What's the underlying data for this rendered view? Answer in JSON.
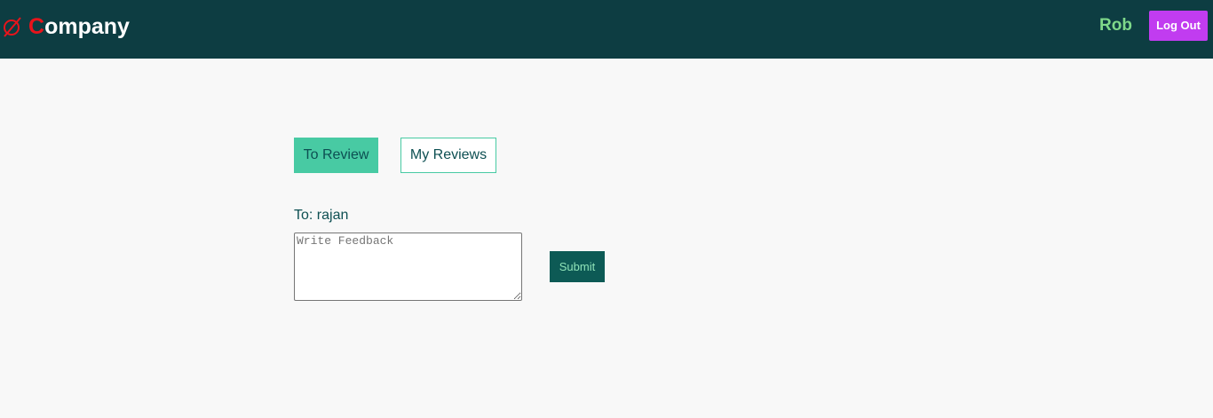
{
  "header": {
    "brand_initial": "C",
    "brand_rest": "ompany",
    "brand_icon": "empty-set-icon",
    "user_name": "Rob",
    "logout_label": "Log Out"
  },
  "tabs": [
    {
      "label": "To Review",
      "active": true
    },
    {
      "label": "My Reviews",
      "active": false
    }
  ],
  "review": {
    "to_label": "To: rajan",
    "feedback_placeholder": "Write Feedback",
    "feedback_value": "",
    "submit_label": "Submit"
  },
  "colors": {
    "navbar_bg": "#0d3d42",
    "brand_accent": "#e8141b",
    "user_name": "#7fd98a",
    "logout_bg": "#c13cf0",
    "tab_active_bg": "#48caa3",
    "submit_bg": "#0d5a55",
    "page_bg": "#f8f8f8"
  }
}
